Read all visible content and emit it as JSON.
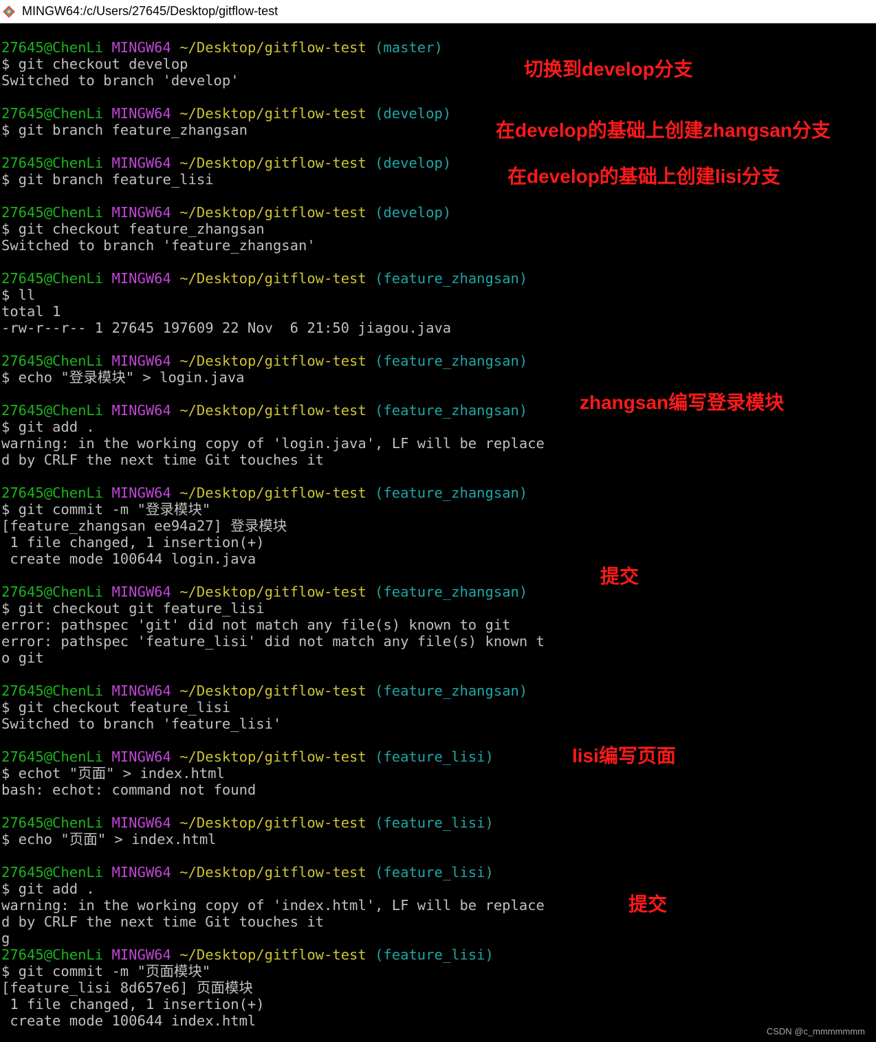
{
  "window": {
    "title": "MINGW64:/c/Users/27645/Desktop/gitflow-test"
  },
  "prompt": {
    "user": "27645@ChenLi",
    "host": "MINGW64",
    "path": "~/Desktop/gitflow-test"
  },
  "lines": [
    {
      "type": "prompt",
      "branch": "(master)"
    },
    {
      "type": "text",
      "text": "$ git checkout develop"
    },
    {
      "type": "text",
      "text": "Switched to branch 'develop'"
    },
    {
      "type": "blank"
    },
    {
      "type": "prompt",
      "branch": "(develop)"
    },
    {
      "type": "text",
      "text": "$ git branch feature_zhangsan"
    },
    {
      "type": "blank"
    },
    {
      "type": "prompt",
      "branch": "(develop)"
    },
    {
      "type": "text",
      "text": "$ git branch feature_lisi"
    },
    {
      "type": "blank"
    },
    {
      "type": "prompt",
      "branch": "(develop)"
    },
    {
      "type": "text",
      "text": "$ git checkout feature_zhangsan"
    },
    {
      "type": "text",
      "text": "Switched to branch 'feature_zhangsan'"
    },
    {
      "type": "blank"
    },
    {
      "type": "prompt",
      "branch": "(feature_zhangsan)"
    },
    {
      "type": "text",
      "text": "$ ll"
    },
    {
      "type": "text",
      "text": "total 1"
    },
    {
      "type": "text",
      "text": "-rw-r--r-- 1 27645 197609 22 Nov  6 21:50 jiagou.java"
    },
    {
      "type": "blank"
    },
    {
      "type": "prompt",
      "branch": "(feature_zhangsan)"
    },
    {
      "type": "text",
      "text": "$ echo \"登录模块\" > login.java"
    },
    {
      "type": "blank"
    },
    {
      "type": "prompt",
      "branch": "(feature_zhangsan)"
    },
    {
      "type": "text",
      "text": "$ git add ."
    },
    {
      "type": "text",
      "text": "warning: in the working copy of 'login.java', LF will be replace"
    },
    {
      "type": "text",
      "text": "d by CRLF the next time Git touches it"
    },
    {
      "type": "blank"
    },
    {
      "type": "prompt",
      "branch": "(feature_zhangsan)"
    },
    {
      "type": "text",
      "text": "$ git commit -m \"登录模块\""
    },
    {
      "type": "text",
      "text": "[feature_zhangsan ee94a27] 登录模块"
    },
    {
      "type": "text",
      "text": " 1 file changed, 1 insertion(+)"
    },
    {
      "type": "text",
      "text": " create mode 100644 login.java"
    },
    {
      "type": "blank"
    },
    {
      "type": "prompt",
      "branch": "(feature_zhangsan)"
    },
    {
      "type": "text",
      "text": "$ git checkout git feature_lisi"
    },
    {
      "type": "text",
      "text": "error: pathspec 'git' did not match any file(s) known to git"
    },
    {
      "type": "text",
      "text": "error: pathspec 'feature_lisi' did not match any file(s) known t"
    },
    {
      "type": "text",
      "text": "o git"
    },
    {
      "type": "blank"
    },
    {
      "type": "prompt",
      "branch": "(feature_zhangsan)"
    },
    {
      "type": "text",
      "text": "$ git checkout feature_lisi"
    },
    {
      "type": "text",
      "text": "Switched to branch 'feature_lisi'"
    },
    {
      "type": "blank"
    },
    {
      "type": "prompt",
      "branch": "(feature_lisi)"
    },
    {
      "type": "text",
      "text": "$ echot \"页面\" > index.html"
    },
    {
      "type": "text",
      "text": "bash: echot: command not found"
    },
    {
      "type": "blank"
    },
    {
      "type": "prompt",
      "branch": "(feature_lisi)"
    },
    {
      "type": "text",
      "text": "$ echo \"页面\" > index.html"
    },
    {
      "type": "blank"
    },
    {
      "type": "prompt",
      "branch": "(feature_lisi)"
    },
    {
      "type": "text",
      "text": "$ git add ."
    },
    {
      "type": "text",
      "text": "warning: in the working copy of 'index.html', LF will be replace"
    },
    {
      "type": "text",
      "text": "d by CRLF the next time Git touches it"
    },
    {
      "type": "text",
      "text": "g"
    },
    {
      "type": "prompt",
      "branch": "(feature_lisi)"
    },
    {
      "type": "text",
      "text": "$ git commit -m \"页面模块\""
    },
    {
      "type": "text",
      "text": "[feature_lisi 8d657e6] 页面模块"
    },
    {
      "type": "text",
      "text": " 1 file changed, 1 insertion(+)"
    },
    {
      "type": "text",
      "text": " create mode 100644 index.html"
    }
  ],
  "annotations": [
    {
      "id": "switch-develop",
      "text": "切换到develop分支"
    },
    {
      "id": "create-zhangsan",
      "text": "在develop的基础上创建zhangsan分支"
    },
    {
      "id": "create-lisi",
      "text": "在develop的基础上创建lisi分支"
    },
    {
      "id": "zhangsan-login",
      "text": "zhangsan编写登录模块"
    },
    {
      "id": "commit-1",
      "text": "提交"
    },
    {
      "id": "lisi-page",
      "text": "lisi编写页面"
    },
    {
      "id": "commit-2",
      "text": "提交"
    }
  ],
  "colors": {
    "user": "#1cb51c",
    "host": "#bf47d6",
    "path": "#cfc534",
    "branch": "#1fa6a6",
    "text": "#c0c0c0",
    "annotation": "#ff1a1a"
  },
  "watermark": "CSDN @c_mmmmmmm"
}
